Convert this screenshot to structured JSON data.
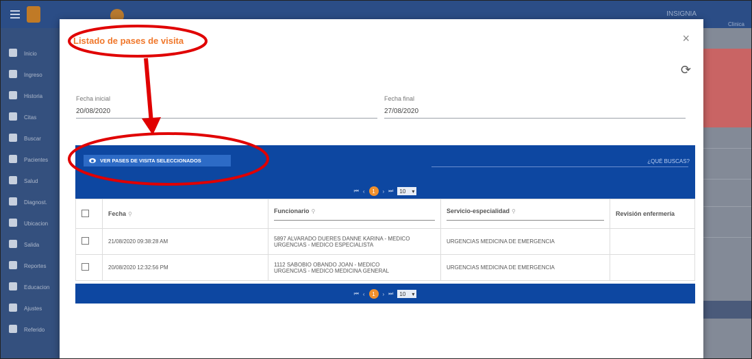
{
  "background": {
    "topbar_text": "INSIGNIA",
    "topbar_subtext": "Clinica",
    "sidebar_items": [
      "Inicio",
      "Ingreso",
      "Historia",
      "Citas",
      "Buscar",
      "Pacientes",
      "Salud",
      "Diagnost.",
      "Ubicacion",
      "Salida",
      "Reportes",
      "Educacion",
      "Ajustes",
      "Referido"
    ]
  },
  "modal": {
    "title": "Listado de pases de visita",
    "close_icon": "×",
    "refresh_icon": "⟳",
    "fecha_inicial": {
      "label": "Fecha inicial",
      "value": "20/08/2020"
    },
    "fecha_final": {
      "label": "Fecha final",
      "value": "27/08/2020"
    },
    "ver_pases_button": "VER PASES DE VISITA SELECCIONADOS",
    "search_placeholder": "¿QUÉ BUSCAS?",
    "pager": {
      "first": "⏮",
      "prev": "‹",
      "page": "1",
      "next": "›",
      "last": "⏭",
      "page_size": "10",
      "page_size_arrow": "▾"
    },
    "table": {
      "headers": [
        "Fecha",
        "Funcionario",
        "Servicio-especialidad",
        "Revisión enfermería"
      ],
      "filter_icon": "⚲",
      "rows": [
        {
          "fecha": "21/08/2020 09:38:28 AM",
          "funcionario_line1": "5897 ALVARADO DUERES DANNE KARINA - MEDICO",
          "funcionario_line2": "URGENCIAS - MEDICO ESPECIALISTA",
          "servicio": "URGENCIAS MEDICINA DE EMERGENCIA",
          "revision": ""
        },
        {
          "fecha": "20/08/2020 12:32:56 PM",
          "funcionario_line1": "1112 SABOBIO OBANDO JOAN - MEDICO",
          "funcionario_line2": "URGENCIAS - MEDICO MEDICINA GENERAL",
          "servicio": "URGENCIAS MEDICINA DE EMERGENCIA",
          "revision": ""
        }
      ]
    }
  },
  "colors": {
    "accent_orange": "#f0772a",
    "primary_blue": "#0d47a1",
    "annotation_red": "#e00000"
  }
}
